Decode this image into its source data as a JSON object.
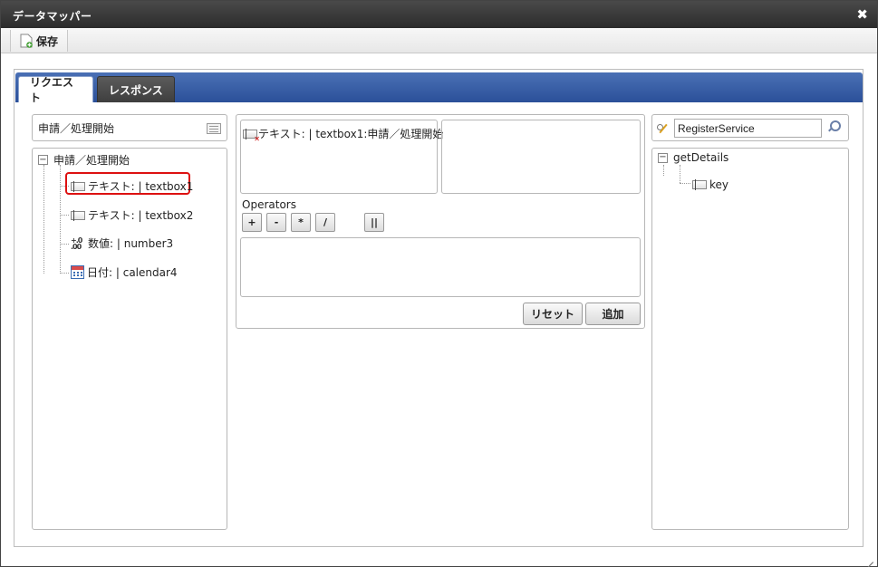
{
  "window": {
    "title": "データマッパー",
    "close_label": "✖"
  },
  "toolbar": {
    "save_label": "保存"
  },
  "tabs": [
    {
      "label": "リクエスト",
      "active": true
    },
    {
      "label": "レスポンス",
      "active": false
    }
  ],
  "left": {
    "title": "申請／処理開始",
    "tree": {
      "root": {
        "expander": "−",
        "label": "申請／処理開始"
      },
      "items": [
        {
          "icon": "textbox-icon",
          "label": "テキスト: | textbox1",
          "highlighted": true
        },
        {
          "icon": "textbox-icon",
          "label": "テキスト: | textbox2"
        },
        {
          "icon": "number-icon",
          "icon_text": "+.0\n.00",
          "label": "数値: | number3"
        },
        {
          "icon": "calendar-icon",
          "label": "日付: | calendar4"
        }
      ]
    }
  },
  "middle": {
    "source_field": "テキスト: | textbox1:申請／処理開始",
    "operators_label": "Operators",
    "operators": [
      "+",
      "-",
      "*",
      "/",
      "||"
    ],
    "reset_label": "リセット",
    "add_label": "追加"
  },
  "right": {
    "service_value": "RegisterService",
    "tree": {
      "root": {
        "expander": "−",
        "label": "getDetails"
      },
      "items": [
        {
          "icon": "textbox-icon",
          "label": "key"
        }
      ]
    }
  },
  "colors": {
    "tab_bar": "#2b5099",
    "highlight": "#dd1111",
    "titlebar": "#333333"
  }
}
